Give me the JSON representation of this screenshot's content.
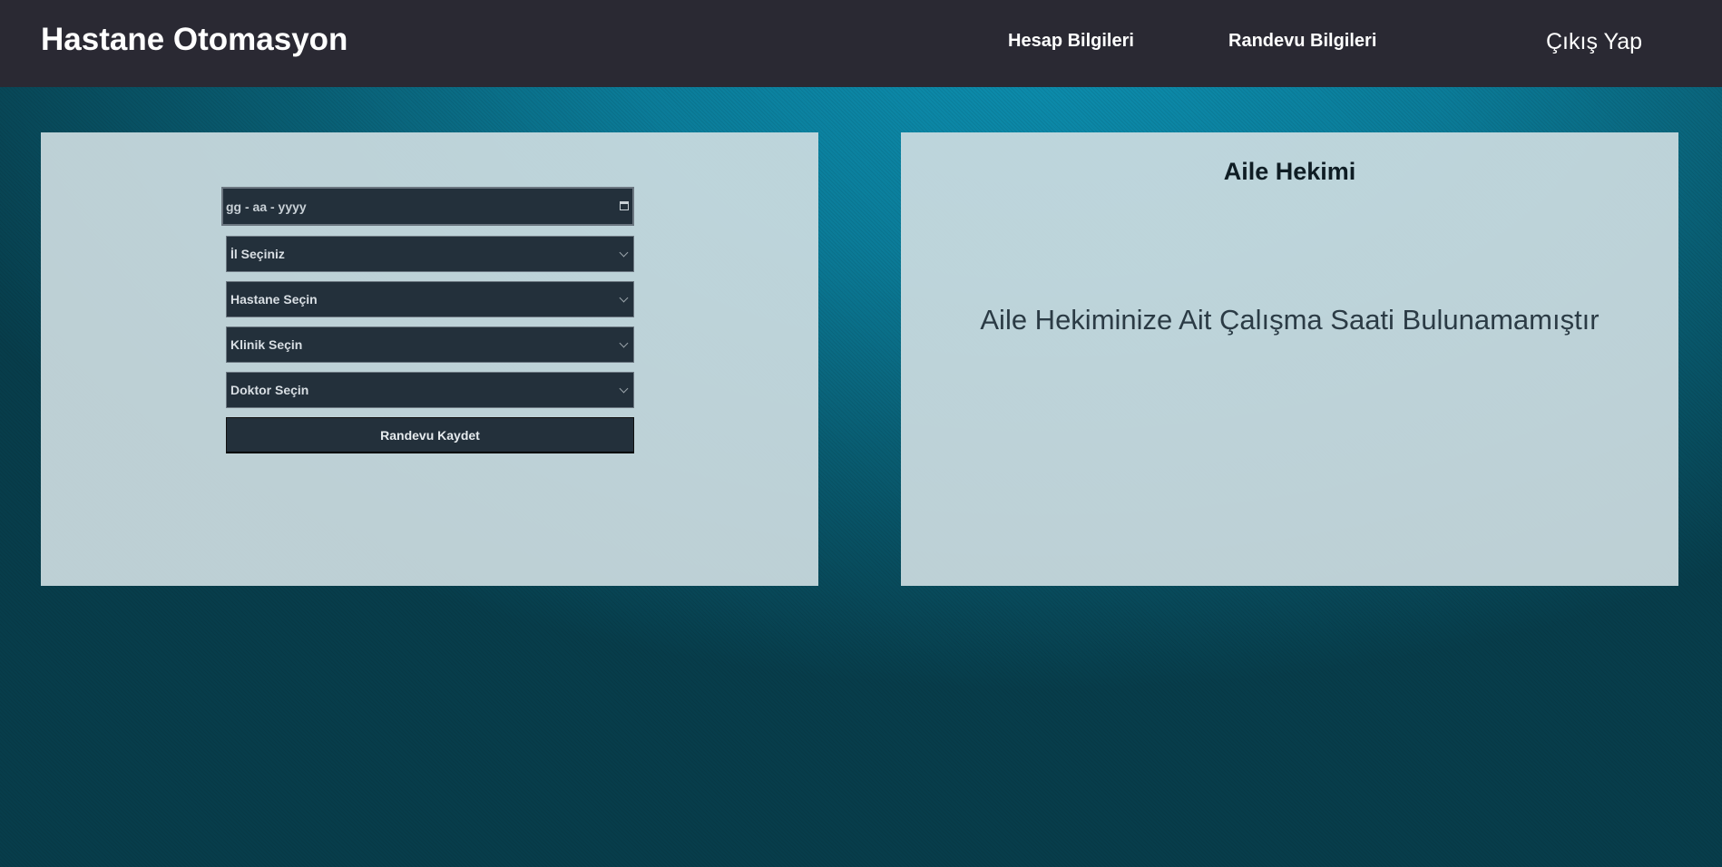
{
  "header": {
    "brand": "Hastane Otomasyon",
    "nav": {
      "account": "Hesap Bilgileri",
      "appointments": "Randevu Bilgileri",
      "logout": "Çıkış Yap"
    }
  },
  "appointment_form": {
    "date_placeholder": "gg - aa - yyyy",
    "province_select": "İl Seçiniz",
    "hospital_select": "Hastane Seçin",
    "clinic_select": "Klinik Seçin",
    "doctor_select": "Doktor Seçin",
    "submit_label": "Randevu Kaydet",
    "icons": [
      "calendar-icon",
      "chevron-down-icon"
    ]
  },
  "family_doctor": {
    "title": "Aile Hekimi",
    "message": "Aile Hekiminize Ait Çalışma Saati Bulunamamıştır"
  },
  "colors": {
    "header_bg": "#2a2933",
    "panel_bg": "#cddce1",
    "field_bg": "#23303b",
    "page_bg_accent": "#0c8fb0"
  }
}
